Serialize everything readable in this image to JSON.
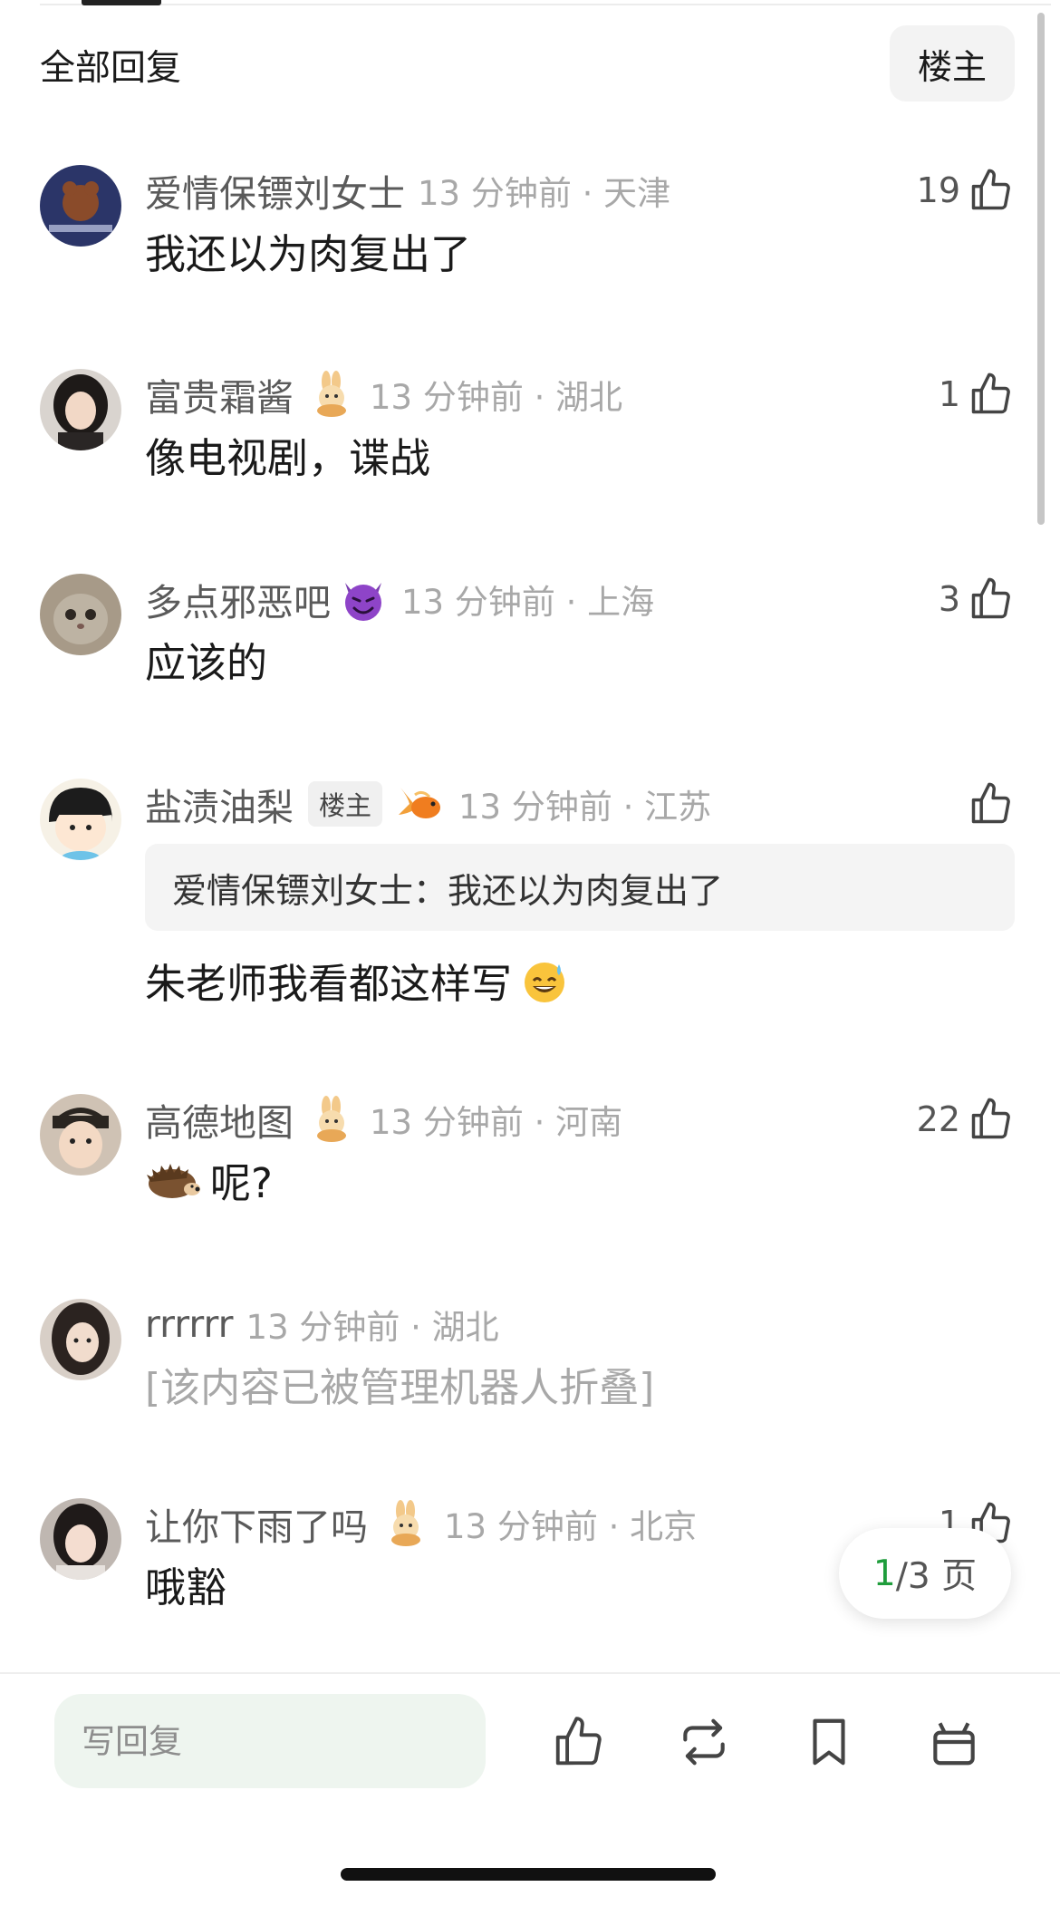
{
  "header": {
    "title": "全部回复",
    "op_filter_label": "楼主"
  },
  "comments": [
    {
      "username": "爱情保镖刘女士",
      "time_location": "13 分钟前 · 天津",
      "likes": "19",
      "text": "我还以为肉复出了",
      "medal": ""
    },
    {
      "username": "富贵霜酱",
      "time_location": "13 分钟前 · 湖北",
      "likes": "1",
      "text": "像电视剧，谍战",
      "medal": "rabbit-medal-icon"
    },
    {
      "username": "多点邪恶吧",
      "time_location": "13 分钟前 · 上海",
      "likes": "3",
      "text": "应该的",
      "name_emoji": "smiling-devil-icon"
    },
    {
      "username": "盐渍油梨",
      "op_badge": "楼主",
      "time_location": "13 分钟前 · 江苏",
      "likes": "",
      "quote": "爱情保镖刘女士：我还以为肉复出了",
      "text": "朱老师我看都这样写",
      "medal": "goldfish-medal-icon",
      "trailing_emoji": "sweat-smile-icon"
    },
    {
      "username": "高德地图",
      "time_location": "13 分钟前 · 河南",
      "likes": "22",
      "text": "呢?",
      "medal": "rabbit-medal-icon",
      "leading_emoji": "hedgehog-icon"
    },
    {
      "username": "rrrrrr",
      "time_location": "13 分钟前 · 湖北",
      "likes": "",
      "text": "[该内容已被管理机器人折叠]"
    },
    {
      "username": "让你下雨了吗",
      "time_location": "13 分钟前 · 北京",
      "likes": "1",
      "text": "哦豁",
      "medal": "rabbit-medal-icon"
    }
  ],
  "pager": {
    "current": "1",
    "rest": "/3 页"
  },
  "bottom_bar": {
    "reply_placeholder": "写回复"
  },
  "colors": {
    "accent_green": "#1f9d3c",
    "input_bg": "#eef5ef",
    "meta_gray": "#a8a8a8"
  }
}
